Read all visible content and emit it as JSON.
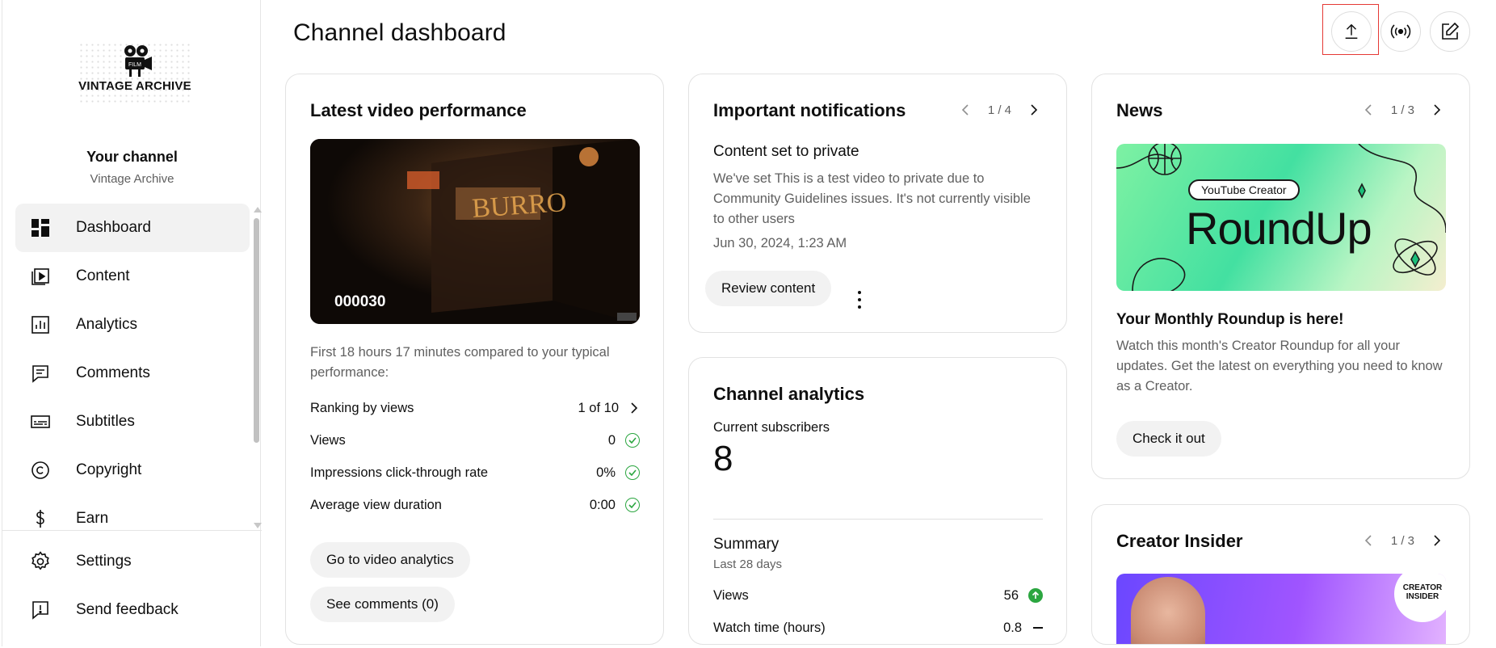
{
  "sidebar": {
    "logo_text": "VINTAGE ARCHIVE",
    "logo_badge": "FILM",
    "channel_title": "Your channel",
    "channel_name": "Vintage Archive",
    "items": [
      {
        "label": "Dashboard",
        "icon": "dashboard-icon",
        "active": true
      },
      {
        "label": "Content",
        "icon": "content-icon"
      },
      {
        "label": "Analytics",
        "icon": "analytics-icon"
      },
      {
        "label": "Comments",
        "icon": "comments-icon"
      },
      {
        "label": "Subtitles",
        "icon": "subtitles-icon"
      },
      {
        "label": "Copyright",
        "icon": "copyright-icon"
      },
      {
        "label": "Earn",
        "icon": "earn-icon"
      }
    ],
    "bottom_items": [
      {
        "label": "Settings",
        "icon": "gear-icon"
      },
      {
        "label": "Send feedback",
        "icon": "feedback-icon"
      }
    ]
  },
  "header": {
    "title": "Channel dashboard",
    "actions": [
      "upload-icon",
      "live-icon",
      "create-post-icon"
    ]
  },
  "latest_video": {
    "title": "Latest video performance",
    "thumbnail_label": "000030",
    "note": "First 18 hours 17 minutes compared to your typical performance:",
    "metrics": [
      {
        "label": "Ranking by views",
        "value": "1 of 10",
        "indicator": "chevron"
      },
      {
        "label": "Views",
        "value": "0",
        "indicator": "check"
      },
      {
        "label": "Impressions click-through rate",
        "value": "0%",
        "indicator": "check"
      },
      {
        "label": "Average view duration",
        "value": "0:00",
        "indicator": "check"
      }
    ],
    "btn_analytics": "Go to video analytics",
    "btn_comments": "See comments (0)"
  },
  "notifications": {
    "title": "Important notifications",
    "pager": "1 / 4",
    "heading": "Content set to private",
    "body": "We've set This is a test video to private due to Community Guidelines issues. It's not currently visible to other users",
    "date": "Jun 30, 2024, 1:23 AM",
    "btn_review": "Review content"
  },
  "channel_analytics": {
    "title": "Channel analytics",
    "subs_label": "Current subscribers",
    "subs_value": "8",
    "summary_title": "Summary",
    "summary_period": "Last 28 days",
    "rows": [
      {
        "label": "Views",
        "value": "56",
        "trend": "up"
      },
      {
        "label": "Watch time (hours)",
        "value": "0.8",
        "trend": "flat"
      }
    ]
  },
  "news": {
    "title": "News",
    "pager": "1 / 3",
    "image_tag": "YouTube Creator",
    "image_title": "RoundUp",
    "heading": "Your Monthly Roundup is here!",
    "body": "Watch this month's Creator Roundup for all your updates. Get the latest on everything you need to know as a Creator.",
    "btn": "Check it out"
  },
  "creator_insider": {
    "title": "Creator Insider",
    "pager": "1 / 3",
    "badge_line1": "CREATOR",
    "badge_line2": "INSIDER"
  },
  "colors": {
    "accent_green": "#2ba640",
    "highlight_red": "#e53935",
    "pill_bg": "#f2f2f2"
  }
}
